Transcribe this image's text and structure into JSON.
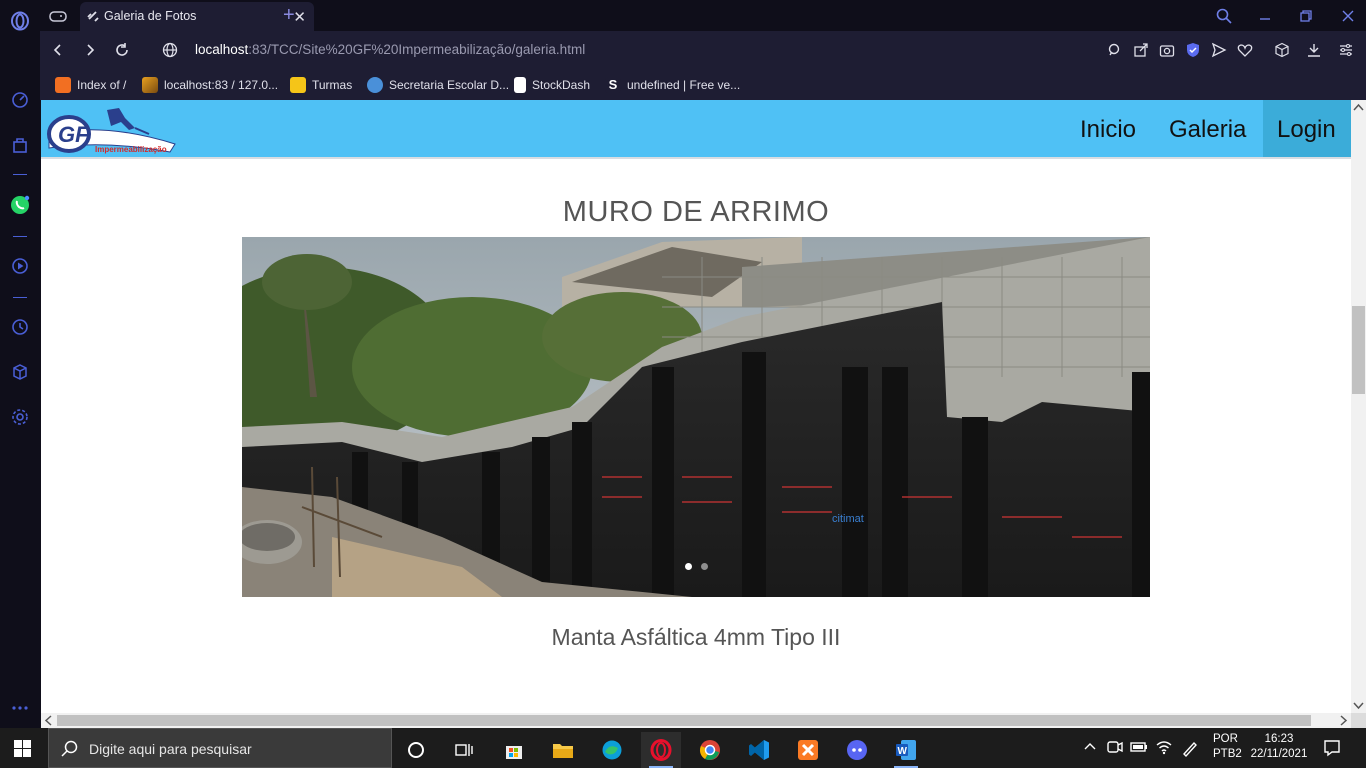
{
  "browser": {
    "tab_title": "Galeria de Fotos",
    "url_host": "localhost",
    "url_rest": ":83/TCC/Site%20GF%20Impermeabilização/galeria.html",
    "bookmarks": [
      {
        "label": "Index of /",
        "color": "#f26f22"
      },
      {
        "label": "localhost:83 / 127.0...",
        "color": "#e8a020"
      },
      {
        "label": "Turmas",
        "color": "#f5c518"
      },
      {
        "label": "Secretaria Escolar D...",
        "color": "#4a90d9"
      },
      {
        "label": "StockDash",
        "color": "#ffffff"
      },
      {
        "label": "undefined | Free ve...",
        "color": "#1e88e5"
      }
    ]
  },
  "site": {
    "logo_text": "GF",
    "logo_sub": "Impermeabilização",
    "nav": {
      "home": "Inicio",
      "gallery": "Galeria",
      "login": "Login"
    },
    "section_title": "MURO DE ARRIMO",
    "caption": "Manta Asfáltica 4mm Tipo III",
    "carousel": {
      "slide_count": 2,
      "active_slide": 1,
      "brand_print": "citimat"
    }
  },
  "taskbar": {
    "search_placeholder": "Digite aqui para pesquisar",
    "lang_top": "POR",
    "lang_bottom": "PTB2",
    "time": "16:23",
    "date": "22/11/2021"
  },
  "colors": {
    "nav_bg": "#4fc1f5",
    "nav_active": "#3bacd9",
    "browser_bg": "#0f0e1a",
    "toolbar_bg": "#1e1d33",
    "accent": "#4a5fd6"
  }
}
